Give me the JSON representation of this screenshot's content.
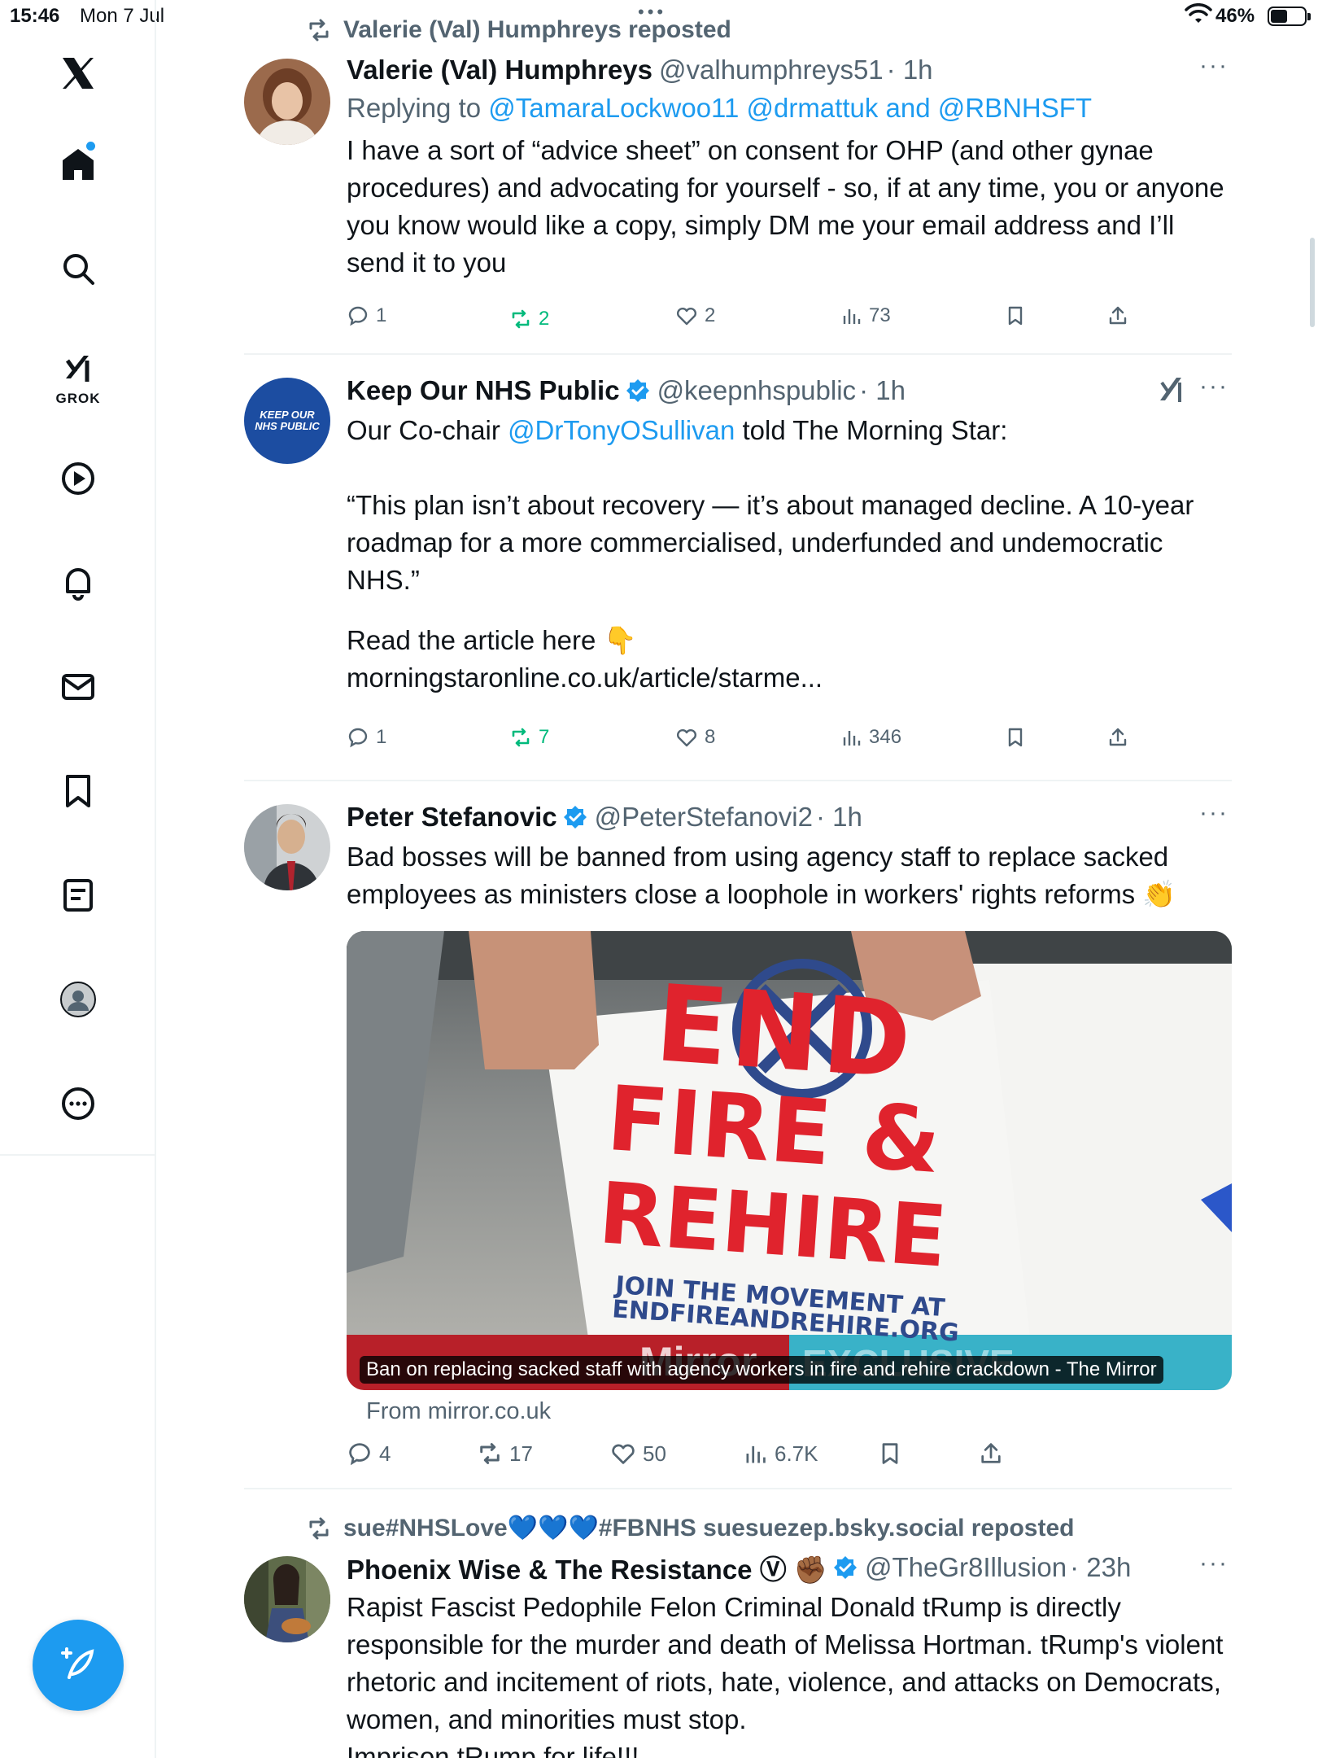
{
  "status_bar": {
    "time": "15:46",
    "date": "Mon 7 Jul",
    "battery": "46%",
    "handle_dots": "•••"
  },
  "nav": {
    "grok_label": "GROK",
    "items": [
      "x-logo",
      "home",
      "search",
      "grok",
      "video",
      "notifications",
      "messages",
      "bookmarks",
      "lists",
      "profile",
      "more"
    ]
  },
  "tweets": [
    {
      "reposted_by": "Valerie (Val) Humphreys reposted",
      "name": "Valerie (Val) Humphreys",
      "handle": "@valhumphreys51",
      "time": "· 1h",
      "replying_prefix": "Replying to ",
      "replying_to": "@TamaraLockwoo11 @drmattuk and @RBNHSFT",
      "text": "I have a sort of “advice sheet” on consent for OHP (and other gynae procedures) and advocating for yourself - so, if at any time, you or anyone you know would like a copy, simply DM me your email address and I’ll send it to you",
      "replies": "1",
      "reposts": "2",
      "likes": "2",
      "views": "73"
    },
    {
      "name": "Keep Our NHS Public",
      "handle": "@keepnhspublic",
      "time": "· 1h",
      "avatar_text": "KEEP OUR NHS PUBLIC",
      "text_pre": "Our Co-chair ",
      "mention": "@DrTonyOSullivan",
      "text_post": " told The Morning Star:",
      "quote": "“This plan isn’t about recovery — it’s about managed decline. A 10-year roadmap for a more commercialised, underfunded and undemocratic NHS.”",
      "read_more": "Read the article here 👇",
      "link": "morningstaronline.co.uk/article/starme...",
      "replies": "1",
      "reposts": "7",
      "likes": "8",
      "views": "346"
    },
    {
      "name": "Peter Stefanovic",
      "handle": "@PeterStefanovi2",
      "time": "· 1h",
      "text": "Bad bosses will be banned from using agency staff to replace sacked employees as ministers close a loophole in workers' rights reforms 👏",
      "card": {
        "sign_line1": "END",
        "sign_line2": "FIRE &",
        "sign_line3": "REHIRE",
        "sign_small": "JOIN THE MOVEMENT AT",
        "sign_small2": "ENDFIREANDREHIRE.ORG",
        "brand_left": "Mirror",
        "brand_right": "EXCLUSIVE",
        "caption": "Ban on replacing sacked staff with agency workers in fire and rehire crackdown - The Mirror"
      },
      "from": "From mirror.co.uk",
      "replies": "4",
      "reposts": "17",
      "likes": "50",
      "views": "6.7K"
    },
    {
      "reposted_by": "sue#NHSLove💙💙💙#FBNHS suesuezep.bsky.social reposted",
      "name": "Phoenix Wise & The Resistance Ⓥ ✊🏾",
      "handle": "@TheGr8Illusion",
      "time": "· 23h",
      "text": "Rapist Fascist Pedophile Felon Criminal Donald tRump is directly responsible for the murder and death of Melissa Hortman. tRump's violent rhetoric and incitement of riots, hate, violence, and attacks on Democrats, women, and minorities must stop.\nImprison tRump for life!!!"
    }
  ],
  "colors": {
    "accent": "#1d9bf0",
    "repost_green": "#00ba7c",
    "muted": "#536471",
    "sign_red": "#e0232d"
  }
}
